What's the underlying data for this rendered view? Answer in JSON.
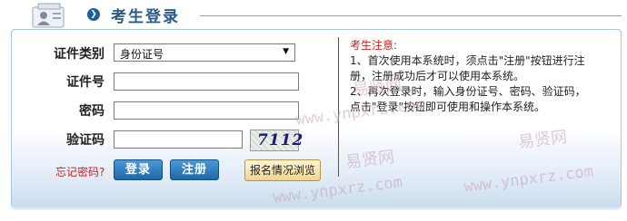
{
  "header": {
    "title": "考生登录"
  },
  "form": {
    "id_type_label": "证件类别",
    "id_type_value": "身份证号",
    "id_number_label": "证件号",
    "password_label": "密码",
    "captcha_label": "验证码",
    "captcha_code": "7112",
    "forgot_link": "忘记密码?",
    "login_button": "登录",
    "register_button": "注册",
    "browse_button": "报名情况浏览"
  },
  "notice": {
    "title": "考生注意:",
    "line1": "1、首次使用本系统时，须点击\"注册\"按钮进行注",
    "line2": "册，注册成功后才可以使用本系统。",
    "line3": "2、再次登录时，输入身份证号、密码、验证码，",
    "line4": "点击\"登录\"按钮即可使用和操作本系统。"
  },
  "watermarks": {
    "site_name": "易贤网",
    "site_url": "www.ynpxrz.com"
  },
  "colors": {
    "header_title": "#2c5a86",
    "accent_blue": "#1f67a8",
    "notice_red": "#cc2222"
  }
}
